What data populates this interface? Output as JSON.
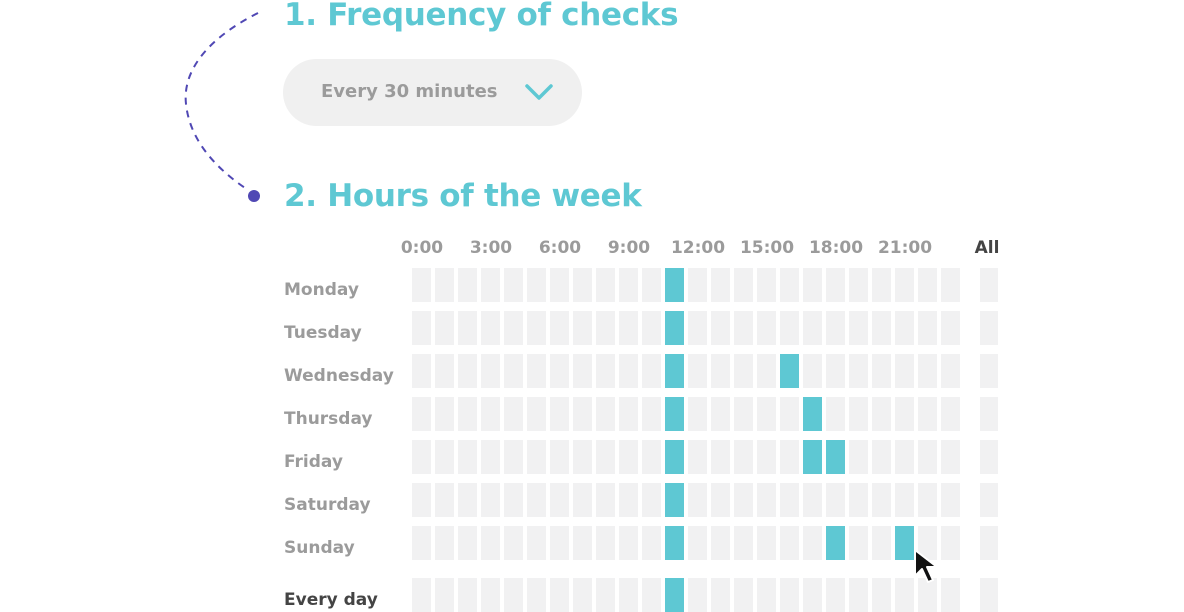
{
  "steps": {
    "frequency_title": "1. Frequency of checks",
    "hours_title": "2. Hours of the week"
  },
  "frequency": {
    "selected": "Every 30 minutes",
    "icon": "chevron-down-icon"
  },
  "schedule": {
    "hour_labels": [
      "0:00",
      "3:00",
      "6:00",
      "9:00",
      "12:00",
      "15:00",
      "18:00",
      "21:00"
    ],
    "all_label": "All",
    "slots_per_day": 24,
    "rows": [
      {
        "day": "Monday",
        "active_hours": [
          11
        ]
      },
      {
        "day": "Tuesday",
        "active_hours": [
          11
        ]
      },
      {
        "day": "Wednesday",
        "active_hours": [
          11,
          16
        ]
      },
      {
        "day": "Thursday",
        "active_hours": [
          11,
          17
        ]
      },
      {
        "day": "Friday",
        "active_hours": [
          11,
          17,
          18
        ]
      },
      {
        "day": "Saturday",
        "active_hours": [
          11
        ]
      },
      {
        "day": "Sunday",
        "active_hours": [
          11,
          18,
          21
        ]
      },
      {
        "day": "Every day",
        "active_hours": [
          11
        ],
        "total": true
      }
    ]
  },
  "colors": {
    "accent": "#5ec8d3",
    "cell_off": "#f1f1f2",
    "connector": "#5048b4",
    "label_muted": "#9b9b9b",
    "label_dark": "#444444"
  }
}
